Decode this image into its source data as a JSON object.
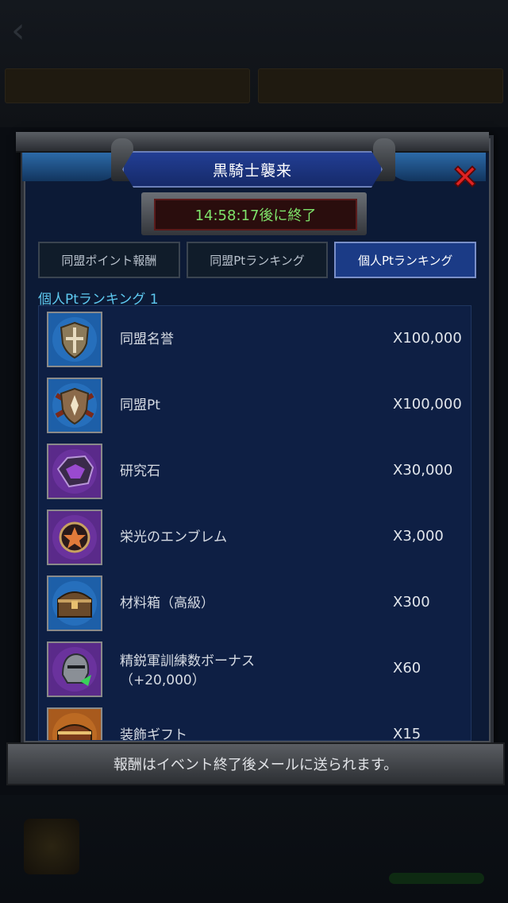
{
  "event_title": "黒騎士襲来",
  "timer": "14:58:17後に終了",
  "tabs": [
    {
      "label": "同盟ポイント報酬"
    },
    {
      "label": "同盟Ptランキング"
    },
    {
      "label": "個人Ptランキング"
    }
  ],
  "active_tab": 2,
  "section_label": "個人Ptランキング 1",
  "rewards": [
    {
      "name": "同盟名誉",
      "qty": "X100,000",
      "icon": "shield-icon",
      "icon_bg": "#1d5fa8"
    },
    {
      "name": "同盟Pt",
      "qty": "X100,000",
      "icon": "crossed-shield-icon",
      "icon_bg": "#1d5fa8"
    },
    {
      "name": "研究石",
      "qty": "X30,000",
      "icon": "research-stone-icon",
      "icon_bg": "#5a2a8a"
    },
    {
      "name": "栄光のエンブレム",
      "qty": "X3,000",
      "icon": "emblem-icon",
      "icon_bg": "#5a2a8a"
    },
    {
      "name": "材料箱（高級）",
      "qty": "X300",
      "icon": "chest-icon",
      "icon_bg": "#1d5fa8"
    },
    {
      "name": "精鋭軍訓練数ボーナス",
      "name2": "（+20,000）",
      "qty": "X60",
      "icon": "helmet-icon",
      "icon_bg": "#5a2a8a"
    },
    {
      "name": "装飾ギフト",
      "qty": "X15",
      "icon": "gift-chest-icon",
      "icon_bg": "#a85a1d"
    }
  ],
  "footer_note": "報酬はイベント終了後メールに送られます。"
}
